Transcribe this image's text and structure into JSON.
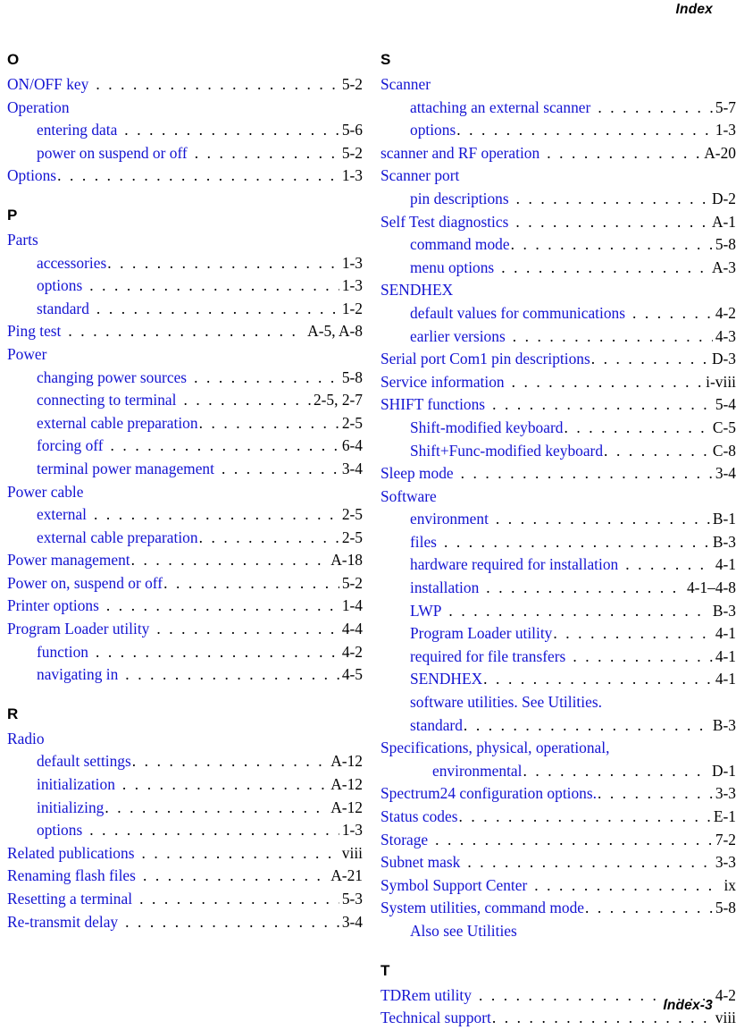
{
  "header": {
    "title": "Index"
  },
  "footer": {
    "page_label": "Index-3"
  },
  "colors": {
    "entry_text": "#1414d2",
    "page_number": "#000000",
    "heading": "#000000"
  },
  "columns": {
    "left": [
      {
        "letter": "O",
        "entries": [
          {
            "text": "ON/OFF key",
            "page": "5-2",
            "level": 0,
            "gap": true
          },
          {
            "text": "Operation",
            "page": "",
            "level": 0,
            "plain": true
          },
          {
            "text": "entering data",
            "page": "5-6",
            "level": 1,
            "gap": true
          },
          {
            "text": "power on suspend or off",
            "page": "5-2",
            "level": 1,
            "gap": true
          },
          {
            "text": "Options",
            "page": "1-3",
            "level": 0
          }
        ]
      },
      {
        "letter": "P",
        "entries": [
          {
            "text": "Parts",
            "page": "",
            "level": 0,
            "plain": true
          },
          {
            "text": "accessories",
            "page": "1-3",
            "level": 1
          },
          {
            "text": "options",
            "page": "1-3",
            "level": 1,
            "gap": true
          },
          {
            "text": "standard",
            "page": "1-2",
            "level": 1,
            "gap": true
          },
          {
            "text": "Ping test",
            "page": "A-5, A-8",
            "level": 0,
            "gap": true
          },
          {
            "text": "Power",
            "page": "",
            "level": 0,
            "plain": true
          },
          {
            "text": "changing power sources",
            "page": "5-8",
            "level": 1,
            "gap": true
          },
          {
            "text": "connecting to terminal",
            "page": "2-5, 2-7",
            "level": 1,
            "gap": true
          },
          {
            "text": "external cable preparation",
            "page": "2-5",
            "level": 1
          },
          {
            "text": "forcing off",
            "page": "6-4",
            "level": 1,
            "gap": true
          },
          {
            "text": "terminal power management",
            "page": "3-4",
            "level": 1,
            "gap": true
          },
          {
            "text": "Power cable",
            "page": "",
            "level": 0,
            "plain": true
          },
          {
            "text": "external",
            "page": "2-5",
            "level": 1,
            "gap": true
          },
          {
            "text": "external cable preparation",
            "page": "2-5",
            "level": 1
          },
          {
            "text": "Power management",
            "page": "A-18",
            "level": 0
          },
          {
            "text": "Power on, suspend or off",
            "page": "5-2",
            "level": 0
          },
          {
            "text": "Printer options",
            "page": "1-4",
            "level": 0,
            "gap": true
          },
          {
            "text": "Program Loader utility",
            "page": "4-4",
            "level": 0,
            "gap": true
          },
          {
            "text": "function",
            "page": "4-2",
            "level": 1,
            "gap": true
          },
          {
            "text": "navigating in",
            "page": "4-5",
            "level": 1,
            "gap": true
          }
        ]
      },
      {
        "letter": "R",
        "entries": [
          {
            "text": "Radio",
            "page": "",
            "level": 0,
            "plain": true
          },
          {
            "text": "default settings",
            "page": "A-12",
            "level": 1
          },
          {
            "text": "initialization",
            "page": "A-12",
            "level": 1,
            "gap": true
          },
          {
            "text": "initializing",
            "page": "A-12",
            "level": 1
          },
          {
            "text": "options",
            "page": "1-3",
            "level": 1,
            "gap": true
          },
          {
            "text": "Related publications",
            "page": "viii",
            "level": 0,
            "gap": true
          },
          {
            "text": "Renaming flash files",
            "page": "A-21",
            "level": 0,
            "gap": true
          },
          {
            "text": "Resetting a terminal",
            "page": "5-3",
            "level": 0,
            "gap": true
          },
          {
            "text": "Re-transmit delay",
            "page": "3-4",
            "level": 0,
            "gap": true
          }
        ]
      }
    ],
    "right": [
      {
        "letter": "S",
        "entries": [
          {
            "text": "Scanner",
            "page": "",
            "level": 0,
            "plain": true
          },
          {
            "text": "attaching an external scanner",
            "page": "5-7",
            "level": 1,
            "gap": true
          },
          {
            "text": "options",
            "page": "1-3",
            "level": 1
          },
          {
            "text": "scanner and RF operation",
            "page": "A-20",
            "level": 0,
            "gap": true
          },
          {
            "text": "Scanner port",
            "page": "",
            "level": 0,
            "plain": true
          },
          {
            "text": "pin descriptions",
            "page": "D-2",
            "level": 1,
            "gap": true
          },
          {
            "text": "Self Test diagnostics",
            "page": "A-1",
            "level": 0,
            "gap": true
          },
          {
            "text": "command mode",
            "page": "5-8",
            "level": 1
          },
          {
            "text": "menu options",
            "page": "A-3",
            "level": 1,
            "gap": true
          },
          {
            "text": "SENDHEX",
            "page": "",
            "level": 0,
            "plain": true
          },
          {
            "text": "default values for communications",
            "page": "4-2",
            "level": 1,
            "gap": true
          },
          {
            "text": "earlier versions",
            "page": "4-3",
            "level": 1,
            "gap": true
          },
          {
            "text": "Serial port Com1 pin descriptions",
            "page": "D-3",
            "level": 0
          },
          {
            "text": "Service information",
            "page": "i-viii",
            "level": 0,
            "gap": true
          },
          {
            "text": "SHIFT functions",
            "page": "5-4",
            "level": 0,
            "gap": true
          },
          {
            "text": "Shift-modified keyboard",
            "page": "C-5",
            "level": 1
          },
          {
            "text": "Shift+Func-modified keyboard",
            "page": "C-8",
            "level": 1
          },
          {
            "text": "Sleep mode",
            "page": "3-4",
            "level": 0,
            "gap": true
          },
          {
            "text": "Software",
            "page": "",
            "level": 0,
            "plain": true
          },
          {
            "text": "environment",
            "page": "B-1",
            "level": 1,
            "gap": true
          },
          {
            "text": "files",
            "page": "B-3",
            "level": 1,
            "gap": true
          },
          {
            "text": "hardware required for installation",
            "page": "4-1",
            "level": 1,
            "gap": true
          },
          {
            "text": "installation",
            "page": "4-1–4-8",
            "level": 1,
            "gap": true
          },
          {
            "text": "LWP",
            "page": "B-3",
            "level": 1,
            "gap": true
          },
          {
            "text": "Program Loader utility",
            "page": "4-1",
            "level": 1
          },
          {
            "text": "required for file transfers",
            "page": "4-1",
            "level": 1,
            "gap": true
          },
          {
            "text": "SENDHEX",
            "page": "4-1",
            "level": 1
          },
          {
            "text": "software utilities. See Utilities.",
            "page": "",
            "level": 1,
            "plain": true
          },
          {
            "text": "standard",
            "page": "B-3",
            "level": 1
          },
          {
            "text": "Specifications, physical, operational,",
            "page": "",
            "level": 0,
            "plain": true
          },
          {
            "text": "environmental",
            "page": "D-1",
            "level": 0,
            "cont": true
          },
          {
            "text": "Spectrum24 configuration options.",
            "page": "3-3",
            "level": 0
          },
          {
            "text": "Status codes",
            "page": "E-1",
            "level": 0
          },
          {
            "text": "Storage",
            "page": "7-2",
            "level": 0,
            "gap": true
          },
          {
            "text": "Subnet mask",
            "page": "3-3",
            "level": 0,
            "gap": true
          },
          {
            "text": "Symbol Support Center",
            "page": "ix",
            "level": 0,
            "gap": true
          },
          {
            "text": "System utilities, command mode",
            "page": "5-8",
            "level": 0
          },
          {
            "text": "Also see Utilities",
            "page": "",
            "level": 1,
            "plain": true
          }
        ]
      },
      {
        "letter": "T",
        "entries": [
          {
            "text": "TDRem utility",
            "page": "4-2",
            "level": 0,
            "gap": true
          },
          {
            "text": "Technical support",
            "page": "viii",
            "level": 0
          }
        ]
      }
    ]
  }
}
